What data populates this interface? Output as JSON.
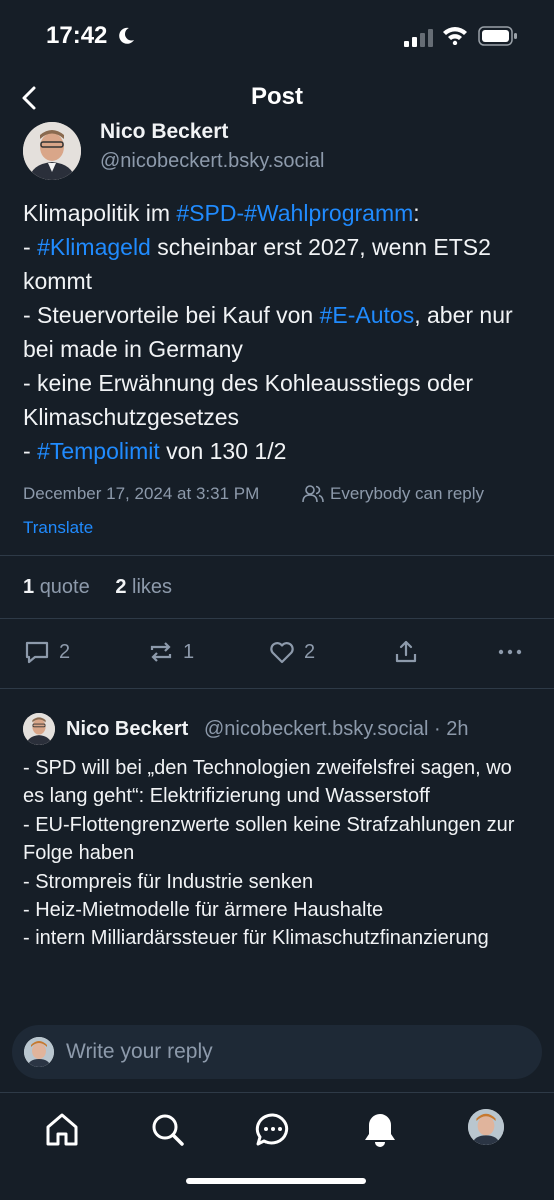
{
  "status": {
    "time": "17:42"
  },
  "nav": {
    "title": "Post"
  },
  "post": {
    "author_name": "Nico Beckert",
    "author_handle": "@nicobeckert.bsky.social",
    "segments": [
      {
        "t": "Klimapolitik im ",
        "tag": false
      },
      {
        "t": "#SPD-#Wahlprogramm",
        "tag": true
      },
      {
        "t": ":\n- ",
        "tag": false
      },
      {
        "t": "#Klimageld",
        "tag": true
      },
      {
        "t": "  scheinbar erst 2027, wenn ETS2 kommt\n- Steuervorteile bei Kauf von ",
        "tag": false
      },
      {
        "t": "#E-Autos",
        "tag": true
      },
      {
        "t": ", aber nur bei made in Germany\n- keine Erwähnung des Kohleausstiegs oder Klimaschutzgesetzes\n- ",
        "tag": false
      },
      {
        "t": "#Tempolimit",
        "tag": true
      },
      {
        "t": " von 130 1/2",
        "tag": false
      }
    ],
    "timestamp": "December 17, 2024 at 3:31 PM",
    "reply_permission": "Everybody can reply",
    "translate_label": "Translate",
    "quotes_count": "1",
    "quotes_label": "quote",
    "likes_count": "2",
    "likes_label": "likes",
    "actions": {
      "replies": "2",
      "reposts": "1",
      "likes": "2"
    }
  },
  "reply": {
    "author_name": "Nico Beckert",
    "author_handle": "@nicobeckert.bsky.social · 2h",
    "text": "- SPD will bei „den Technologien zweifelsfrei sagen, wo es lang geht“: Elektrifizierung und Wasserstoff\n- EU-Flottengrenzwerte sollen keine Strafzahlungen zur Folge haben\n- Strompreis für Industrie senken\n- Heiz-Mietmodelle für ärmere Haushalte\n- intern Milliardärssteuer für Klimaschutzfinanzierung"
  },
  "composer": {
    "placeholder": "Write your reply"
  },
  "tabs": [
    "home-icon",
    "search-icon",
    "chat-icon",
    "bell-icon",
    "profile-avatar"
  ],
  "colors": {
    "background": "#161e27",
    "accent": "#208bfe",
    "muted": "#8d9aab"
  }
}
